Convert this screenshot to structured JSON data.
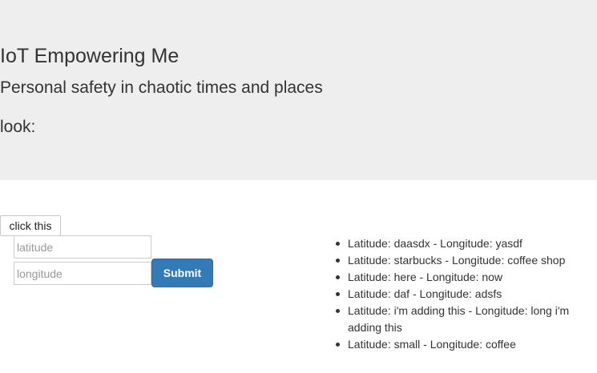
{
  "header": {
    "title": "IoT Empowering Me",
    "subtitle": "Personal safety in chaotic times and places",
    "look_label": "look:"
  },
  "form": {
    "click_button_label": "click this",
    "latitude_placeholder": "latitude",
    "longitude_placeholder": "longitude",
    "latitude_value": "",
    "longitude_value": "",
    "submit_label": "Submit"
  },
  "entries": [
    {
      "text": "Latitude: daasdx - Longitude: yasdf"
    },
    {
      "text": "Latitude: starbucks - Longitude: coffee shop"
    },
    {
      "text": "Latitude: here - Longitude: now"
    },
    {
      "text": "Latitude: daf - Longitude: adsfs"
    },
    {
      "text": "Latitude: i'm adding this - Longitude: long i'm adding this"
    },
    {
      "text": "Latitude: small - Longitude: coffee"
    }
  ],
  "colors": {
    "jumbotron_bg": "#eeeeee",
    "submit_bg": "#337ab7",
    "text": "#333333"
  }
}
